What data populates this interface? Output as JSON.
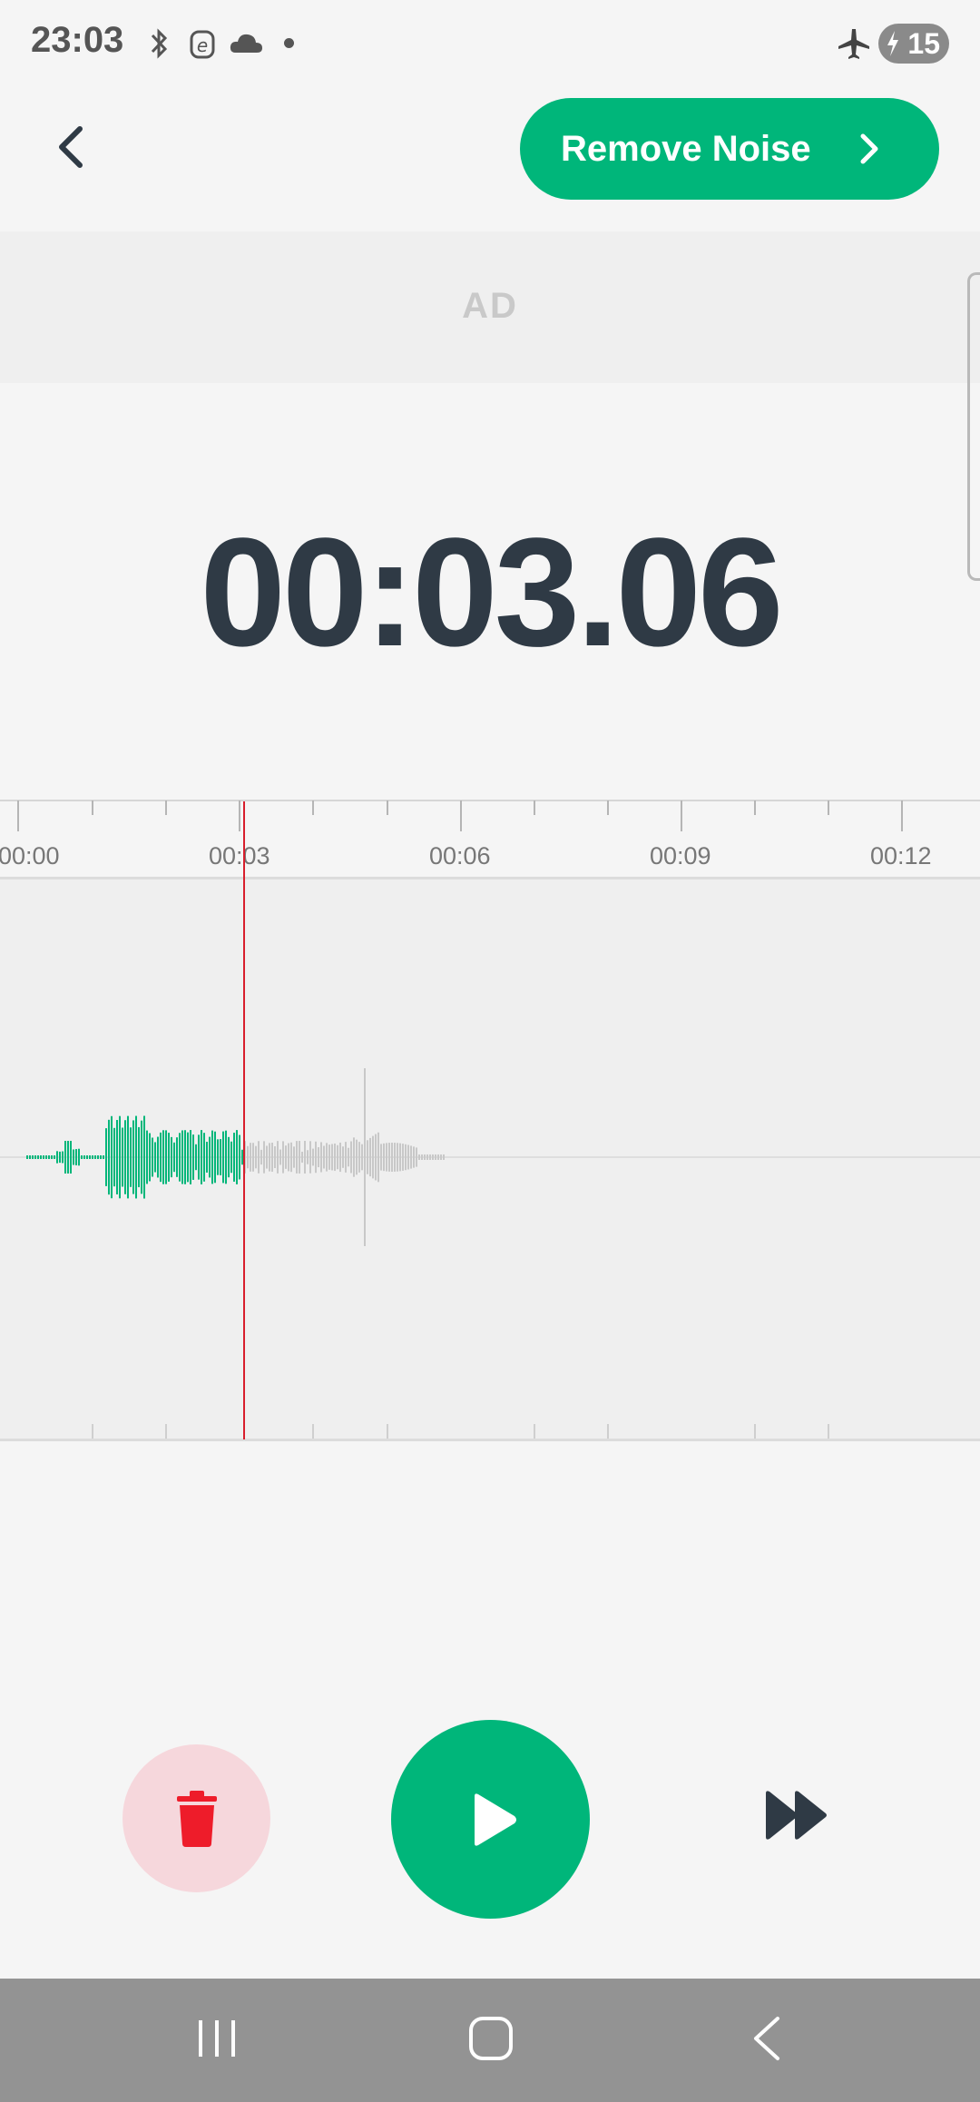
{
  "status_bar": {
    "time": "23:03",
    "icons": [
      "bluetooth-icon",
      "vpn-e-icon",
      "cloud-icon",
      "dot-icon",
      "airplane-icon"
    ],
    "battery": "15"
  },
  "header": {
    "remove_noise_label": "Remove Noise"
  },
  "ad": {
    "label": "AD"
  },
  "timer": {
    "value": "00:03.06"
  },
  "timeline": {
    "labels": [
      "00:00",
      "00:03",
      "00:06",
      "00:09",
      "00:12"
    ],
    "playhead_seconds": 3.06
  },
  "colors": {
    "accent": "#00b67a",
    "playhead": "#d81e2c",
    "delete": "#ee1c2a",
    "delete_bg": "#f6d7dc"
  }
}
